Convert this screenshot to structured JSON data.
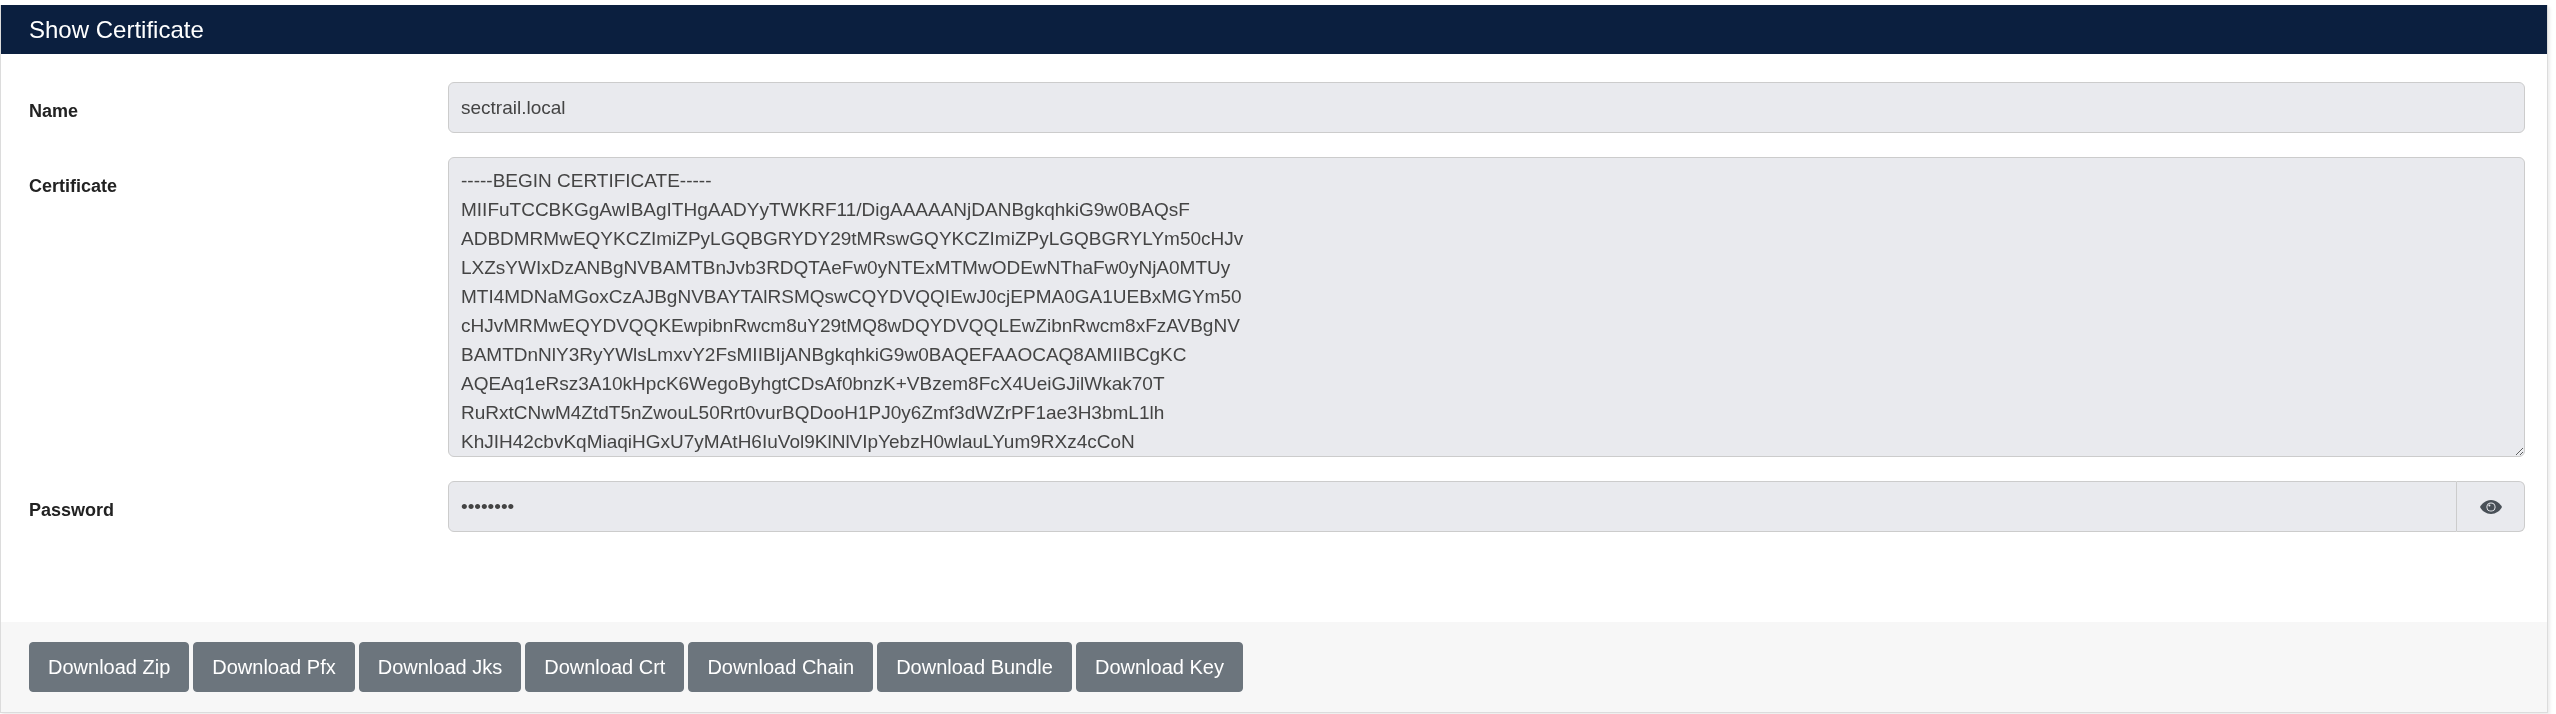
{
  "window": {
    "title": "Show Certificate"
  },
  "fields": [
    {
      "kind": "text",
      "label": "Name",
      "value": "sectrail.local"
    },
    {
      "kind": "textarea",
      "label": "Certificate",
      "lines": [
        "-----BEGIN CERTIFICATE-----",
        "MIIFuTCCBKGgAwIBAgITHgAADYyTWKRF11/DigAAAAANjDANBgkqhkiG9w0BAQsF",
        "ADBDMRMwEQYKCZImiZPyLGQBGRYDY29tMRswGQYKCZImiZPyLGQBGRYLYm50cHJv",
        "LXZsYWIxDzANBgNVBAMTBnJvb3RDQTAeFw0yNTExMTMwODEwNThaFw0yNjA0MTUy",
        "MTI4MDNaMGoxCzAJBgNVBAYTAlRSMQswCQYDVQQIEwJ0cjEPMA0GA1UEBxMGYm50",
        "cHJvMRMwEQYDVQQKEwpibnRwcm8uY29tMQ8wDQYDVQQLEwZibnRwcm8xFzAVBgNV",
        "BAMTDnNlY3RyYWlsLmxvY2FsMIIBIjANBgkqhkiG9w0BAQEFAAOCAQ8AMIIBCgKC",
        "AQEAq1eRsz3A10kHpcK6WegoByhgtCDsAf0bnzK+VBzem8FcX4UeiGJilWkak70T",
        "RuRxtCNwM4ZtdT5nZwouL50Rrt0vurBQDooH1PJ0y6Zmf3dWZrPF1ae3H3bmL1lh",
        "KhJIH42cbvKqMiaqiHGxU7yMAtH6IuVol9KlNlVIpYebzH0wlauLYum9RXz4cCoN"
      ]
    },
    {
      "kind": "password",
      "label": "Password",
      "value": "••••••••"
    }
  ],
  "buttons": [
    "Download Zip",
    "Download Pfx",
    "Download Jks",
    "Download Crt",
    "Download Chain",
    "Download Bundle",
    "Download Key"
  ]
}
